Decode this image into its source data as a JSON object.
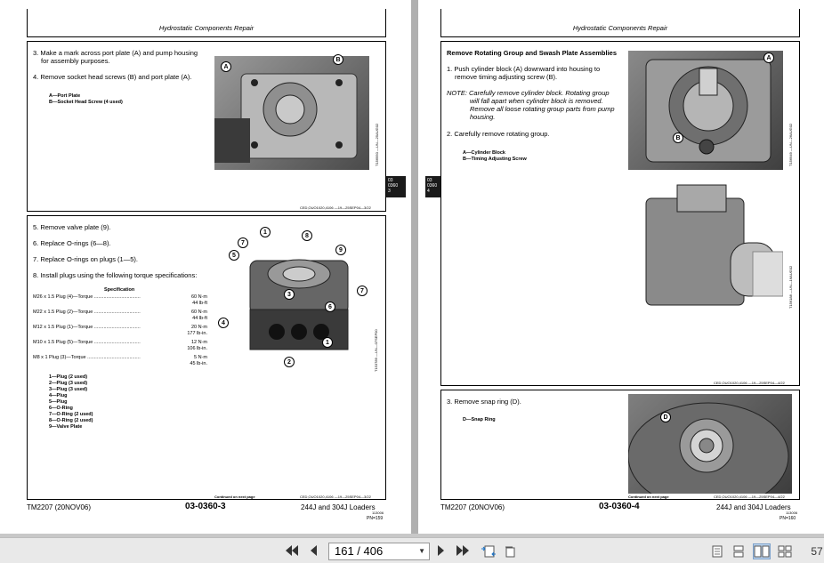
{
  "header_title": "Hydrostatic Components Repair",
  "left": {
    "top_box": {
      "step3": "3.  Make a mark across port plate (A) and pump housing",
      "step3b": "for assembly purposes.",
      "step4": "4.  Remove socket head screws (B) and port plate (A).",
      "legend_a": "A—Port Plate",
      "legend_b": "B—Socket Head Screw (4 used)",
      "callout_a": "A",
      "callout_b": "B",
      "vcode": "T156950  —UN—25AUG02",
      "foot": "CED,OUO1020,4106  —19—25SEP04—3/22"
    },
    "bottom_box": {
      "step5": "5.  Remove valve plate (9).",
      "step6": "6.  Replace O-rings (6—8).",
      "step7": "7.  Replace O-rings on plugs (1—5).",
      "step8": "8.  Install plugs using the following torque specifications:",
      "spec_title": "Specification",
      "specs": [
        {
          "label": "M26 x 1.5 Plug (4)—Torque ..................................",
          "v1": "60 N·m",
          "v2": "44 lb-ft"
        },
        {
          "label": "M22 x 1.5 Plug (2)—Torque ..................................",
          "v1": "60 N·m",
          "v2": "44 lb-ft"
        },
        {
          "label": "M12 x 1.5 Plug (1)—Torque ..................................",
          "v1": "20 N·m",
          "v2": "177 lb-in."
        },
        {
          "label": "M10 x 1.5 Plug (5)—Torque ..................................",
          "v1": "12 N·m",
          "v2": "106 lb-in."
        },
        {
          "label": "M8 x 1 Plug (3)—Torque .......................................",
          "v1": "5 N·m",
          "v2": "45 lb-in."
        }
      ],
      "legend": [
        "1—Plug (2 used)",
        "2—Plug (3 used)",
        "3—Plug (3 used)",
        "4—Plug",
        "5—Plug",
        "6—O-Ring",
        "7—O-Ring (2 used)",
        "8—O-Ring (2 used)",
        "9—Valve Plate"
      ],
      "vcode": "T153789  —UN—07SEP00",
      "cont": "Continued on next page",
      "foot": "CED,OUO1020,4106  —19—25SEP04—3/22"
    },
    "tab": [
      "03",
      "0360",
      "3"
    ],
    "footer_left": "TM2207 (20NOV06)",
    "footer_center": "03-0360-3",
    "footer_right": "244J and 304J Loaders",
    "footer_code": "113006",
    "footer_pn": "PN=159"
  },
  "right": {
    "top_box": {
      "title": "Remove Rotating Group and Swash Plate Assemblies",
      "step1": "1.  Push cylinder block (A) downward into housing to",
      "step1b": "remove timing adjusting screw (B).",
      "note1": "NOTE:  Carefully remove cylinder block. Rotating group",
      "note2": "will fall apart when cylinder block is removed.",
      "note3": "Remove all loose rotating group parts from pump",
      "note4": "housing.",
      "step2": "2.  Carefully remove rotating group.",
      "legend_a": "A—Cylinder Block",
      "legend_b": "B—Timing Adjusting Screw",
      "callout_a": "A",
      "callout_b": "B",
      "vcode1": "T156949  —UN—26AUG02",
      "vcode2": "T156188  —UN—16AUG02",
      "foot": "CED,OUO1020,4106  —19—25SEP04—4/22"
    },
    "bottom_box": {
      "step3": "3.  Remove snap ring (D).",
      "legend_d": "D—Snap Ring",
      "callout_d": "D",
      "cont": "Continued on next page",
      "foot": "CED,OUO1020,4106  —19—25SEP04—4/22"
    },
    "tab": [
      "03",
      "0360",
      "4"
    ],
    "footer_left": "TM2207 (20NOV06)",
    "footer_center": "03-0360-4",
    "footer_right": "244J and 304J Loaders",
    "footer_code": "113006",
    "footer_pn": "PN=160"
  },
  "toolbar": {
    "page_value": "161 / 406",
    "zoom": "57"
  }
}
